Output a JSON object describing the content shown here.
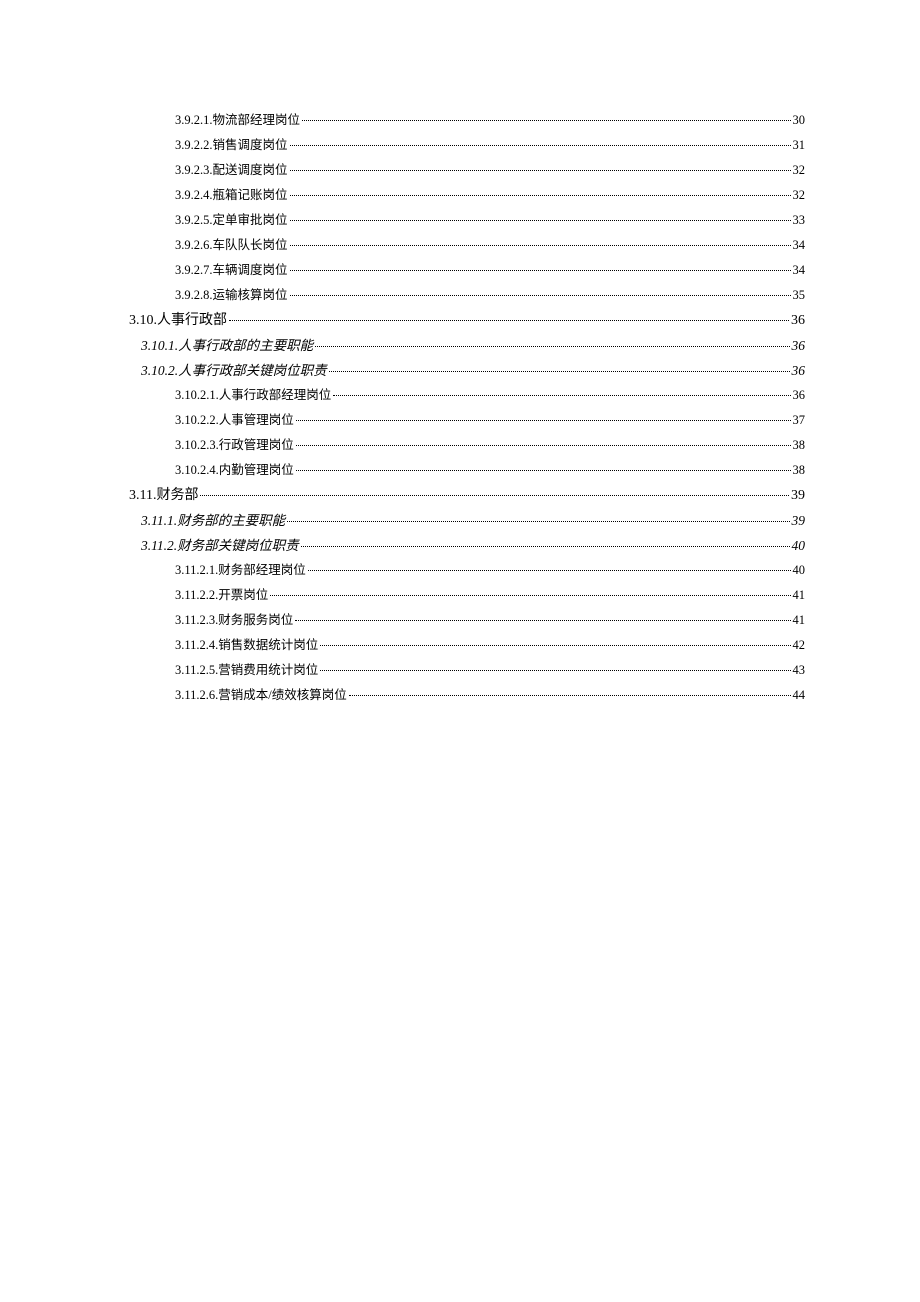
{
  "toc": [
    {
      "level": 3,
      "label": "3.9.2.1.物流部经理岗位",
      "page": "30"
    },
    {
      "level": 3,
      "label": "3.9.2.2.销售调度岗位",
      "page": "31"
    },
    {
      "level": 3,
      "label": "3.9.2.3.配送调度岗位",
      "page": "32"
    },
    {
      "level": 3,
      "label": "3.9.2.4.瓶箱记账岗位",
      "page": "32"
    },
    {
      "level": 3,
      "label": "3.9.2.5.定单审批岗位",
      "page": "33"
    },
    {
      "level": 3,
      "label": "3.9.2.6.车队队长岗位",
      "page": "34"
    },
    {
      "level": 3,
      "label": "3.9.2.7.车辆调度岗位",
      "page": "34"
    },
    {
      "level": 3,
      "label": "3.9.2.8.运输核算岗位",
      "page": "35"
    },
    {
      "level": 1,
      "label": "3.10.人事行政部",
      "page": "36"
    },
    {
      "level": 2,
      "label": "3.10.1.人事行政部的主要职能",
      "page": "36"
    },
    {
      "level": 2,
      "label": "3.10.2.人事行政部关键岗位职责",
      "page": "36"
    },
    {
      "level": 3,
      "label": "3.10.2.1.人事行政部经理岗位",
      "page": "36"
    },
    {
      "level": 3,
      "label": "3.10.2.2.人事管理岗位",
      "page": "37"
    },
    {
      "level": 3,
      "label": "3.10.2.3.行政管理岗位",
      "page": "38"
    },
    {
      "level": 3,
      "label": "3.10.2.4.内勤管理岗位",
      "page": "38"
    },
    {
      "level": 1,
      "label": "3.11.财务部",
      "page": "39"
    },
    {
      "level": 2,
      "label": "3.11.1.财务部的主要职能",
      "page": "39"
    },
    {
      "level": 2,
      "label": "3.11.2.财务部关键岗位职责",
      "page": "40"
    },
    {
      "level": 3,
      "label": "3.11.2.1.财务部经理岗位",
      "page": "40"
    },
    {
      "level": 3,
      "label": "3.11.2.2.开票岗位",
      "page": "41"
    },
    {
      "level": 3,
      "label": "3.11.2.3.财务服务岗位",
      "page": "41"
    },
    {
      "level": 3,
      "label": "3.11.2.4.销售数据统计岗位",
      "page": "42"
    },
    {
      "level": 3,
      "label": "3.11.2.5.营销费用统计岗位",
      "page": "43"
    },
    {
      "level": 3,
      "label": "3.11.2.6.营销成本/绩效核算岗位",
      "page": "44"
    }
  ]
}
